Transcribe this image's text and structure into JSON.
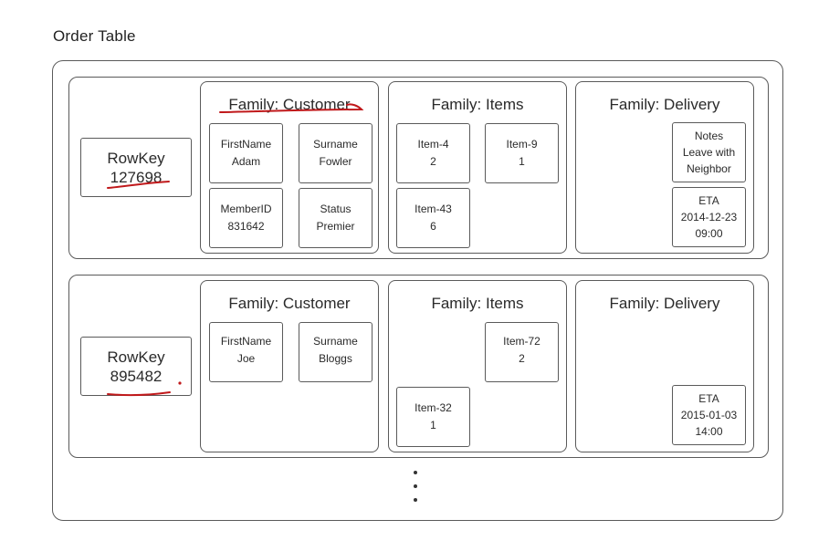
{
  "title": "Order Table",
  "ellipsis": "⋮",
  "annotation_color": "#c0191b",
  "rows": [
    {
      "rowkey_label": "RowKey",
      "rowkey_value": "127698",
      "families": [
        {
          "title": "Family: Customer",
          "cells": [
            {
              "name": "FirstName",
              "value": "Adam"
            },
            {
              "name": "Surname",
              "value": "Fowler"
            },
            {
              "name": "MemberID",
              "value": "831642"
            },
            {
              "name": "Status",
              "value": "Premier"
            }
          ]
        },
        {
          "title": "Family: Items",
          "cells": [
            {
              "name": "Item-4",
              "value": "2"
            },
            {
              "name": "Item-9",
              "value": "1"
            },
            {
              "name": "Item-43",
              "value": "6"
            }
          ]
        },
        {
          "title": "Family: Delivery",
          "cells": [
            {
              "name": "Notes",
              "value": "Leave with",
              "value2": "Neighbor"
            },
            {
              "name": "ETA",
              "value": "2014-12-23",
              "value2": "09:00"
            }
          ]
        }
      ]
    },
    {
      "rowkey_label": "RowKey",
      "rowkey_value": "895482",
      "families": [
        {
          "title": "Family: Customer",
          "cells": [
            {
              "name": "FirstName",
              "value": "Joe"
            },
            {
              "name": "Surname",
              "value": "Bloggs"
            }
          ]
        },
        {
          "title": "Family: Items",
          "cells": [
            {
              "name": "Item-72",
              "value": "2"
            },
            {
              "name": "Item-32",
              "value": "1"
            }
          ]
        },
        {
          "title": "Family: Delivery",
          "cells": [
            {
              "name": "ETA",
              "value": "2015-01-03",
              "value2": "14:00"
            }
          ]
        }
      ]
    }
  ]
}
